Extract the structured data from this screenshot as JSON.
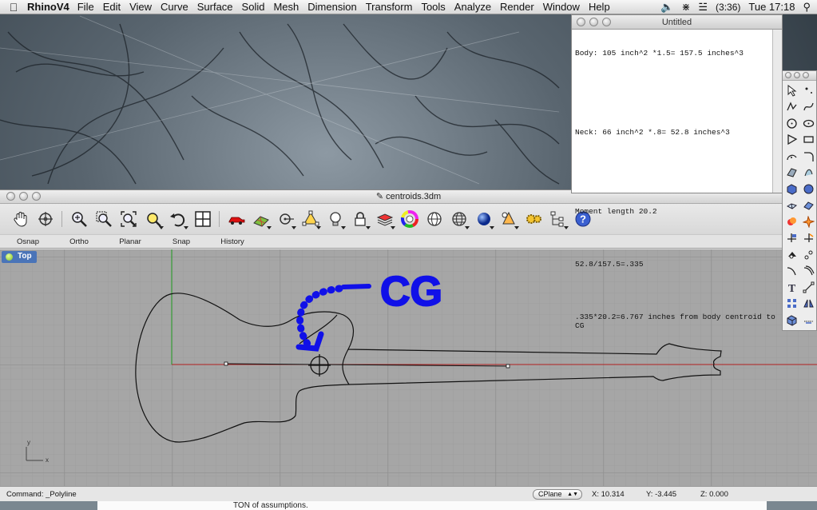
{
  "menubar": {
    "app_name": "RhinoV4",
    "items": [
      "File",
      "Edit",
      "View",
      "Curve",
      "Surface",
      "Solid",
      "Mesh",
      "Dimension",
      "Transform",
      "Tools",
      "Analyze",
      "Render",
      "Window",
      "Help"
    ],
    "battery": "(3:36)",
    "clock": "Tue 17:18"
  },
  "text_window": {
    "title": "Untitled",
    "lines": [
      "Body: 105 inch^2 *1.5= 157.5 inches^3",
      "",
      "",
      "Neck: 66 inch^2 *.8= 52.8 inches^3",
      "",
      "",
      "Moment length 20.2",
      "",
      "52.8/157.5=.335",
      "",
      ".335*20.2=6.767 inches from body centroid to CG"
    ]
  },
  "rhino_window": {
    "title": "centroids.3dm",
    "status_buttons": [
      "Osnap",
      "Ortho",
      "Planar",
      "Snap",
      "History"
    ],
    "viewport_label": "Top",
    "annotation": "CG",
    "axis_icon": {
      "x_label": "x",
      "y_label": "y"
    }
  },
  "command_bar": {
    "command_text": "Command: _Polyline",
    "cplane": "CPlane",
    "x": "X: 10.314",
    "y": "Y: -3.445",
    "z": "Z: 0.000"
  },
  "background_text": "TON of assumptions."
}
